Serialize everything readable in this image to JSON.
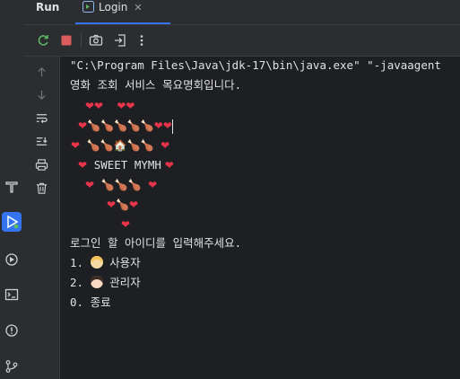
{
  "header": {
    "run_title": "Run",
    "tab_label": "Login",
    "tab_close": "✕"
  },
  "toolbar": {
    "icons": [
      "rerun-icon",
      "stop-icon",
      "camera-icon",
      "exit-icon",
      "more-icon"
    ],
    "colors": {
      "rerun": "#5fb865",
      "stop": "#db5c5c"
    }
  },
  "side_toolbar": {
    "icons": [
      "up-arrow-icon",
      "down-arrow-icon",
      "soft-wrap-icon",
      "scroll-to-end-icon",
      "print-icon",
      "trash-icon"
    ]
  },
  "left_stripe": {
    "icons": [
      "hammer-icon",
      "run-icon",
      "services-icon",
      "terminal-icon",
      "problems-icon",
      "git-icon"
    ],
    "accent": "#3574f0"
  },
  "console": {
    "command_line": "\"C:\\Program Files\\Java\\jdk-17\\bin\\java.exe\" \"-javaagent",
    "welcome": "영화 조회 서비스 목요명회입니다.",
    "art": {
      "row1": "❤❤    ❤❤",
      "row2a": "❤",
      "row2b": "🍗🍗🍗🍗🍗",
      "row2c": "❤❤",
      "row3a": "❤",
      "row3b": "🍗🍗🏠🍗🍗",
      "row3c": "❤",
      "row4a": "❤",
      "row4b": "SWEET MYMH",
      "row4c": "❤",
      "row5a": "❤",
      "row5b": "🍗🍗🍗",
      "row5c": "❤",
      "row6a": "❤",
      "row6b": "🍗",
      "row6c": "❤",
      "row7": "❤"
    },
    "prompt": "로그인 할 아이디를 입력해주세요.",
    "menu": [
      {
        "num": "1.",
        "label": "사용자"
      },
      {
        "num": "2.",
        "label": "관리자"
      },
      {
        "num": "0.",
        "label": "종료"
      }
    ]
  }
}
